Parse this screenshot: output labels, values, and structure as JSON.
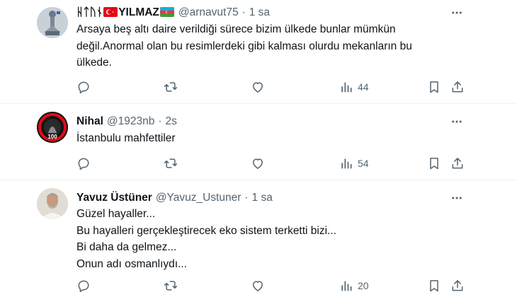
{
  "tweets": [
    {
      "display_name": "ᚺᛏᚢᚾ",
      "display_name_suffix": "YILMAZ",
      "handle": "@arnavut75",
      "separator": "·",
      "time": "1 sa",
      "lines": [
        "Arsaya beş altı daire verildiği sürece bizim ülkede bunlar mümkün",
        "değil.Anormal olan bu resimlerdeki gibi kalması olurdu mekanların bu",
        "ülkede."
      ],
      "views": "44"
    },
    {
      "display_name": "Nihal",
      "handle": "@1923nb",
      "separator": "·",
      "time": "2s",
      "lines": [
        "İstanbulu mahfettiler"
      ],
      "views": "54"
    },
    {
      "display_name": "Yavuz Üstüner",
      "handle": "@Yavuz_Ustuner",
      "separator": "·",
      "time": "1 sa",
      "lines": [
        "Güzel hayaller...",
        "Bu hayalleri gerçekleştirecek eko sistem terketti bizi...",
        "Bi daha da gelmez...",
        "Onun adı osmanlıydı..."
      ],
      "views": "20"
    }
  ],
  "icons": {
    "more": "more-horizontal-icon",
    "reply": "reply-icon",
    "retweet": "retweet-icon",
    "like": "like-icon",
    "views": "views-icon",
    "bookmark": "bookmark-icon",
    "share": "share-icon"
  },
  "colors": {
    "text": "#0f1419",
    "secondary": "#536471",
    "divider": "#eff3f4",
    "turkey_red": "#e30a17",
    "azerbaijan_blue": "#00b5e2",
    "azerbaijan_green": "#3f9c35"
  }
}
